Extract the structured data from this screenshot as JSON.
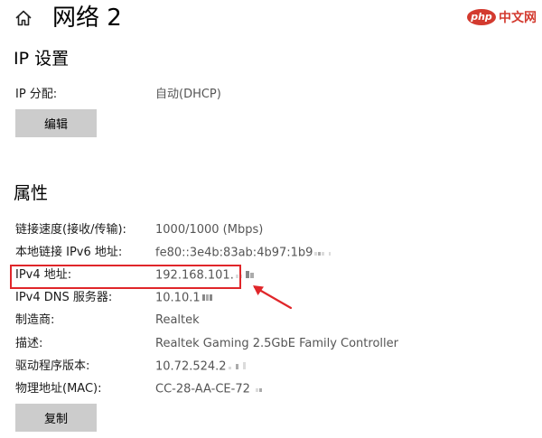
{
  "header": {
    "title": "网络 2",
    "home_icon": "home-icon"
  },
  "watermark": {
    "badge": "php",
    "text": "中文网"
  },
  "ip_settings": {
    "heading": "IP 设置",
    "assignment_label": "IP 分配:",
    "assignment_value": "自动(DHCP)",
    "edit_button": "编辑"
  },
  "properties": {
    "heading": "属性",
    "rows": [
      {
        "label": "链接速度(接收/传输):",
        "value": "1000/1000 (Mbps)"
      },
      {
        "label": "本地链接 IPv6 地址:",
        "value": "fe80::3e4b:83ab:4b97:1b9"
      },
      {
        "label": "IPv4 地址:",
        "value": "192.168.101."
      },
      {
        "label": "IPv4 DNS 服务器:",
        "value": "10.10.1"
      },
      {
        "label": "制造商:",
        "value": "Realtek"
      },
      {
        "label": "描述:",
        "value": "Realtek Gaming 2.5GbE Family Controller"
      },
      {
        "label": "驱动程序版本:",
        "value": "10.72.524.2"
      },
      {
        "label": "物理地址(MAC):",
        "value": "CC-28-AA-CE-72"
      }
    ],
    "copy_button": "复制"
  },
  "annotation": {
    "highlight_color": "#e0262a"
  }
}
